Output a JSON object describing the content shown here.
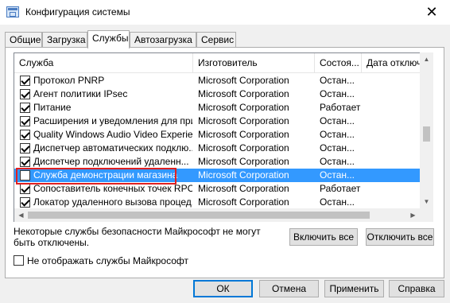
{
  "window": {
    "title": "Конфигурация системы",
    "close_glyph": "✕"
  },
  "tabs": [
    {
      "label": "Общие",
      "active": false
    },
    {
      "label": "Загрузка",
      "active": false
    },
    {
      "label": "Службы",
      "active": true
    },
    {
      "label": "Автозагрузка",
      "active": false
    },
    {
      "label": "Сервис",
      "active": false
    }
  ],
  "columns": {
    "name": "Служба",
    "maker": "Изготовитель",
    "status": "Состоя...",
    "date": "Дата отключ"
  },
  "services": [
    {
      "name": "Протокол PNRP",
      "maker": "Microsoft Corporation",
      "status": "Остан...",
      "checked": true,
      "selected": false
    },
    {
      "name": "Агент политики IPsec",
      "maker": "Microsoft Corporation",
      "status": "Остан...",
      "checked": true,
      "selected": false
    },
    {
      "name": "Питание",
      "maker": "Microsoft Corporation",
      "status": "Работает",
      "checked": true,
      "selected": false
    },
    {
      "name": "Расширения и уведомления для при...",
      "maker": "Microsoft Corporation",
      "status": "Остан...",
      "checked": true,
      "selected": false
    },
    {
      "name": "Quality Windows Audio Video Experience",
      "maker": "Microsoft Corporation",
      "status": "Остан...",
      "checked": true,
      "selected": false
    },
    {
      "name": "Диспетчер автоматических подклю...",
      "maker": "Microsoft Corporation",
      "status": "Остан...",
      "checked": true,
      "selected": false
    },
    {
      "name": "Диспетчер подключений удаленн...",
      "maker": "Microsoft Corporation",
      "status": "Остан...",
      "checked": true,
      "selected": false
    },
    {
      "name": "Служба демонстрации магазина",
      "maker": "Microsoft Corporation",
      "status": "Остан...",
      "checked": false,
      "selected": true
    },
    {
      "name": "Сопоставитель конечных точек RPC",
      "maker": "Microsoft Corporation",
      "status": "Работает",
      "checked": true,
      "selected": false
    },
    {
      "name": "Локатор удаленного вызова процед...",
      "maker": "Microsoft Corporation",
      "status": "Остан...",
      "checked": true,
      "selected": false
    }
  ],
  "note": "Некоторые службы безопасности Майкрософт не могут быть отключены.",
  "buttons": {
    "enable_all": "Включить все",
    "disable_all": "Отключить все",
    "ok": "ОК",
    "cancel": "Отмена",
    "apply": "Применить",
    "help": "Справка"
  },
  "hide_ms": {
    "label": "Не отображать службы Майкрософт",
    "checked": false
  },
  "colors": {
    "selection": "#3399ff",
    "highlight_border": "#e02020"
  }
}
